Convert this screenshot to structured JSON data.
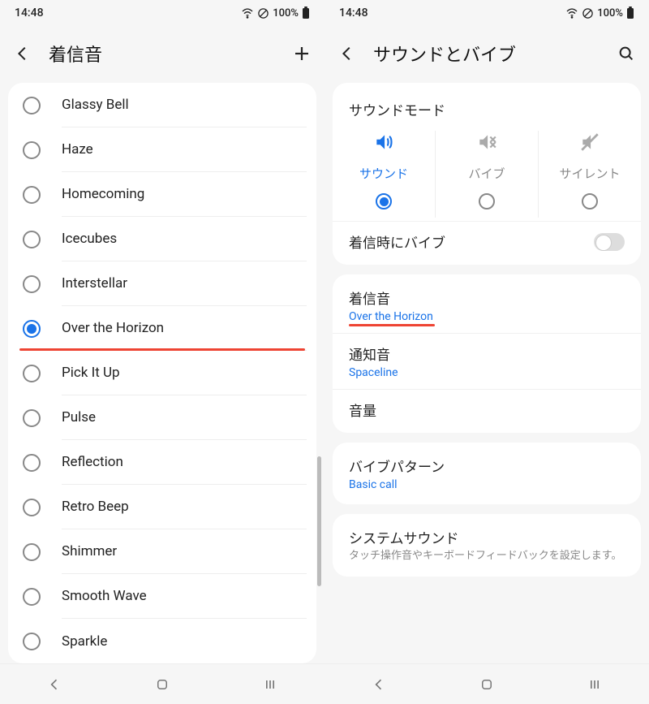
{
  "status": {
    "time": "14:48",
    "battery": "100%"
  },
  "left": {
    "title": "着信音",
    "ringtones": [
      {
        "label": "Glassy Bell",
        "selected": false
      },
      {
        "label": "Haze",
        "selected": false
      },
      {
        "label": "Homecoming",
        "selected": false
      },
      {
        "label": "Icecubes",
        "selected": false
      },
      {
        "label": "Interstellar",
        "selected": false
      },
      {
        "label": "Over the Horizon",
        "selected": true,
        "highlight": true
      },
      {
        "label": "Pick It Up",
        "selected": false
      },
      {
        "label": "Pulse",
        "selected": false
      },
      {
        "label": "Reflection",
        "selected": false
      },
      {
        "label": "Retro Beep",
        "selected": false
      },
      {
        "label": "Shimmer",
        "selected": false
      },
      {
        "label": "Smooth Wave",
        "selected": false
      },
      {
        "label": "Sparkle",
        "selected": false
      }
    ]
  },
  "right": {
    "title": "サウンドとバイブ",
    "sound_mode_title": "サウンドモード",
    "modes": {
      "sound": "サウンド",
      "vibrate": "バイブ",
      "silent": "サイレント"
    },
    "vibrate_on_ring": "着信時にバイブ",
    "ringtone": {
      "title": "着信音",
      "value": "Over the Horizon"
    },
    "notification": {
      "title": "通知音",
      "value": "Spaceline"
    },
    "volume": "音量",
    "vib_pattern": {
      "title": "バイブパターン",
      "value": "Basic call"
    },
    "system_sound": {
      "title": "システムサウンド",
      "desc": "タッチ操作音やキーボードフィードバックを設定します。"
    }
  }
}
